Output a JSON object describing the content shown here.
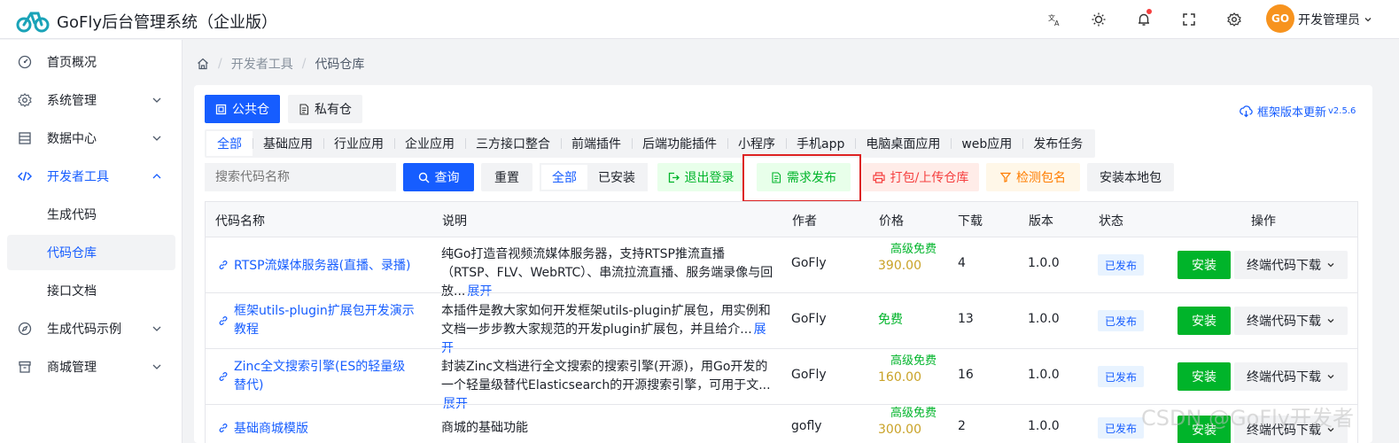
{
  "header": {
    "app_title": "GoFly后台管理系统（企业版）",
    "icons": [
      "translate-icon",
      "theme-icon",
      "bell-icon",
      "fullscreen-icon",
      "settings-icon"
    ],
    "avatar_text": "GO",
    "username": "开发管理员",
    "brand_color": "#165dff"
  },
  "sidebar": {
    "items": [
      {
        "label": "首页概况",
        "icon": "dashboard-icon"
      },
      {
        "label": "系统管理",
        "icon": "gear-icon"
      },
      {
        "label": "数据中心",
        "icon": "list-icon"
      },
      {
        "label": "开发者工具",
        "icon": "code-icon"
      },
      {
        "label": "生成代码"
      },
      {
        "label": "代码仓库"
      },
      {
        "label": "接口文档"
      },
      {
        "label": "生成代码示例",
        "icon": "compass-icon"
      },
      {
        "label": "商城管理",
        "icon": "archive-icon"
      }
    ]
  },
  "breadcrumb": {
    "level1": "开发者工具",
    "level2": "代码仓库"
  },
  "repo_tabs": {
    "public": "公共仓",
    "private": "私有仓"
  },
  "update_link": {
    "label": "框架版本更新",
    "version": "v2.5.6"
  },
  "categories": [
    "全部",
    "基础应用",
    "行业应用",
    "企业应用",
    "三方接口整合",
    "前端插件",
    "后端功能插件",
    "小程序",
    "手机app",
    "电脑桌面应用",
    "web应用",
    "发布任务"
  ],
  "toolbar": {
    "search_placeholder": "搜索代码名称",
    "query": "查询",
    "reset": "重置",
    "filter_all": "全部",
    "filter_installed": "已安装",
    "logout": "退出登录",
    "publish_request": "需求发布",
    "pack_upload": "打包/上传仓库",
    "check_name": "检测包名",
    "install_local": "安装本地包"
  },
  "table": {
    "headers": {
      "name": "代码名称",
      "desc": "说明",
      "author": "作者",
      "price": "价格",
      "downloads": "下载",
      "version": "版本",
      "status": "状态",
      "actions": "操作"
    },
    "rows": [
      {
        "name": "RTSP流媒体服务器(直播、录播)",
        "desc": "纯Go打造音视频流媒体服务器，支持RTSP推流直播（RTSP、FLV、WebRTC）、串流拉流直播、服务端录像与回放...",
        "more": "展开",
        "author": "GoFly",
        "price_tag": "高级免费",
        "price": "390.00",
        "downloads": "4",
        "version": "1.0.0",
        "status": "已发布",
        "install": "安装",
        "download": "终端代码下载"
      },
      {
        "name": "框架utils-plugin扩展包开发演示教程",
        "desc": "本插件是教大家如何开发框架utils-plugin扩展包，用实例和文档一步步教大家规范的开发plugin扩展包，并且给介...",
        "more": "展开",
        "author": "GoFly",
        "price_tag": "",
        "price": "免费",
        "downloads": "13",
        "version": "1.0.0",
        "status": "已发布",
        "install": "安装",
        "download": "终端代码下载"
      },
      {
        "name": "Zinc全文搜索引擎(ES的轻量级替代)",
        "desc": "封装Zinc文档进行全文搜索的搜索引擎(开源)，用Go开发的一个轻量级替代Elasticsearch的开源搜索引擎，可用于文...",
        "more": "展开",
        "author": "GoFly",
        "price_tag": "高级免费",
        "price": "160.00",
        "downloads": "16",
        "version": "1.0.0",
        "status": "已发布",
        "install": "安装",
        "download": "终端代码下载"
      },
      {
        "name": "基础商城模版",
        "desc": "商城的基础功能",
        "more": "",
        "author": "gofly",
        "price_tag": "高级免费",
        "price": "300.00",
        "downloads": "2",
        "version": "1.0.0",
        "status": "已发布",
        "install": "安装",
        "download": "终端代码下载"
      }
    ]
  },
  "watermark": "CSDN @GoFly开发者"
}
